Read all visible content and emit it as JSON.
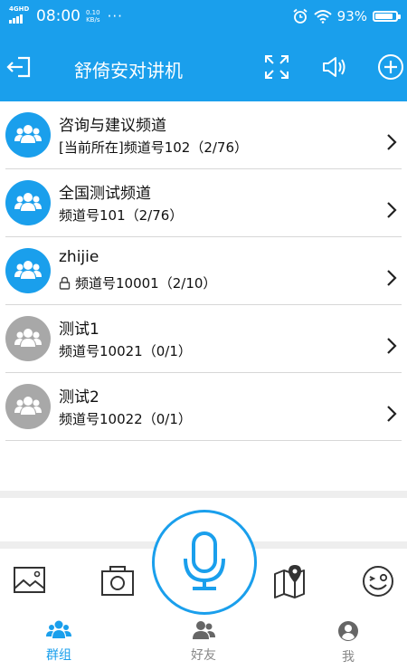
{
  "status_bar": {
    "network": "4GHD",
    "time": "08:00",
    "speed_value": "0.10",
    "speed_unit": "KB/s",
    "more": "···",
    "battery": "93%",
    "battery_level": 0.93
  },
  "header": {
    "title": "舒倚安对讲机",
    "icons": [
      "exit-icon",
      "fullscreen-icon",
      "speaker-icon",
      "add-icon"
    ]
  },
  "channels": [
    {
      "name": "咨询与建议频道",
      "info": "[当前所在]频道号102（2/76）",
      "active": true,
      "locked": false
    },
    {
      "name": "全国测试频道",
      "info": "频道号101（2/76）",
      "active": true,
      "locked": false
    },
    {
      "name": "zhijie",
      "info": "频道号10001（2/10）",
      "active": true,
      "locked": true
    },
    {
      "name": "测试1",
      "info": "频道号10021（0/1）",
      "active": false,
      "locked": false
    },
    {
      "name": "测试2",
      "info": "频道号10022（0/1）",
      "active": false,
      "locked": false
    }
  ],
  "toolbar": {
    "icons": [
      "image-icon",
      "camera-icon",
      "microphone-icon",
      "map-location-icon",
      "emoji-wink-icon"
    ]
  },
  "nav": {
    "items": [
      {
        "label": "群组",
        "icon": "group-icon",
        "active": true
      },
      {
        "label": "好友",
        "icon": "friends-icon",
        "active": false
      },
      {
        "label": "我",
        "icon": "profile-icon",
        "active": false
      }
    ]
  },
  "colors": {
    "primary": "#1a9fec",
    "inactive_avatar": "#a8a8a8",
    "nav_inactive": "#888888",
    "divider": "#d7d7d7"
  }
}
